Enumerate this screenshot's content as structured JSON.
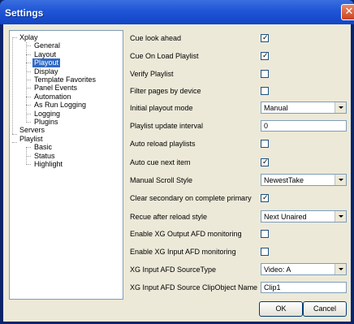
{
  "window": {
    "title": "Settings",
    "close_glyph": "✕"
  },
  "tree": {
    "nodes": [
      {
        "label": "Xplay"
      },
      {
        "label": "General"
      },
      {
        "label": "Layout"
      },
      {
        "label": "Playout",
        "selected": true
      },
      {
        "label": "Display"
      },
      {
        "label": "Template Favorites"
      },
      {
        "label": "Panel Events"
      },
      {
        "label": "Automation"
      },
      {
        "label": "As Run Logging"
      },
      {
        "label": "Logging"
      },
      {
        "label": "Plugins"
      },
      {
        "label": "Servers"
      },
      {
        "label": "Playlist"
      },
      {
        "label": "Basic"
      },
      {
        "label": "Status"
      },
      {
        "label": "Highlight"
      }
    ]
  },
  "settings": [
    {
      "label": "Cue look ahead",
      "control": "checkbox",
      "checked": true
    },
    {
      "label": "Cue On Load Playlist",
      "control": "checkbox",
      "checked": true
    },
    {
      "label": "Verify Playlist",
      "control": "checkbox",
      "checked": false
    },
    {
      "label": "Filter pages by device",
      "control": "checkbox",
      "checked": false
    },
    {
      "label": "Initial playout mode",
      "control": "combo",
      "value": "Manual"
    },
    {
      "label": "Playlist update interval",
      "control": "text",
      "value": "0"
    },
    {
      "label": "Auto reload playlists",
      "control": "checkbox",
      "checked": false
    },
    {
      "label": "Auto cue next item",
      "control": "checkbox",
      "checked": true
    },
    {
      "label": "Manual Scroll Style",
      "control": "combo",
      "value": "NewestTake"
    },
    {
      "label": "Clear secondary on complete primary",
      "control": "checkbox",
      "checked": true
    },
    {
      "label": "Recue after reload style",
      "control": "combo",
      "value": "Next Unaired"
    },
    {
      "label": "Enable XG Output AFD monitoring",
      "control": "checkbox",
      "checked": false
    },
    {
      "label": "Enable XG Input AFD monitoring",
      "control": "checkbox",
      "checked": false
    },
    {
      "label": "XG Input AFD SourceType",
      "control": "combo",
      "value": "Video: A"
    },
    {
      "label": "XG Input AFD Source ClipObject Name",
      "control": "text",
      "value": "Clip1"
    }
  ],
  "buttons": {
    "ok": "OK",
    "cancel": "Cancel"
  },
  "colors": {
    "titlebar": "#1f55d6",
    "selection": "#316ac5",
    "dialog_bg": "#ece9d8"
  }
}
